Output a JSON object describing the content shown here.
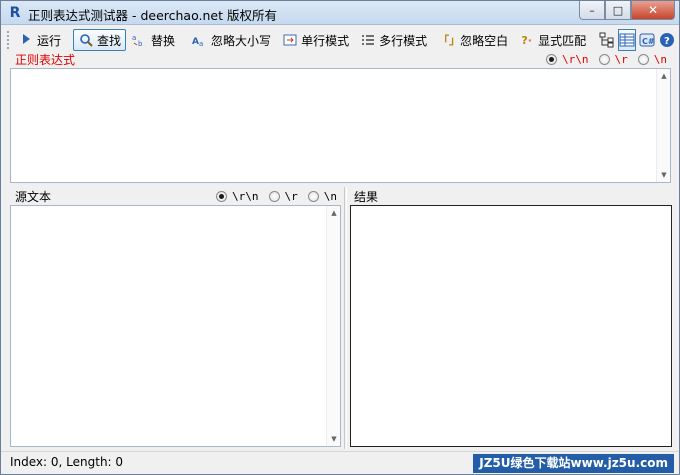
{
  "window": {
    "app_icon": "R",
    "title": "正则表达式测试器 - deerchao.net 版权所有",
    "buttons": {
      "minimize": "–",
      "maximize": "□",
      "close": "✕"
    }
  },
  "toolbar": {
    "run": {
      "label": "运行",
      "icon": "play-icon"
    },
    "find": {
      "label": "查找",
      "icon": "magnifier-icon"
    },
    "replace": {
      "label": "替换",
      "icon": "replace-icon"
    },
    "ignore_case": {
      "label": "忽略大小写",
      "icon": "case-icon"
    },
    "single_line": {
      "label": "单行模式",
      "icon": "single-line-icon"
    },
    "multi_line": {
      "label": "多行模式",
      "icon": "multi-line-icon"
    },
    "ignore_whitespace": {
      "label": "忽略空白",
      "icon_text": "「」"
    },
    "explicit_capture": {
      "label": "显式匹配",
      "icon_text": "?·"
    },
    "extra_icons": [
      "tree-icon",
      "grid-icon",
      "csharp-icon",
      "help-icon",
      "about-icon"
    ]
  },
  "regex": {
    "label": "正则表达式",
    "newline_options": [
      "\\r\\n",
      "\\r",
      "\\n"
    ],
    "selected_newline": "\\r\\n",
    "value": ""
  },
  "source": {
    "label": "源文本",
    "newline_options": [
      "\\r\\n",
      "\\r",
      "\\n"
    ],
    "selected_newline": "\\r\\n",
    "value": ""
  },
  "result": {
    "label": "结果",
    "value": ""
  },
  "status": {
    "text": "Index: 0, Length: 0"
  },
  "watermark": "JZ5U绿色下载站www.jz5u.com",
  "colors": {
    "regex_label": "#e00000",
    "title_bar": "#c5d9ef",
    "close_button": "#c8452c"
  }
}
